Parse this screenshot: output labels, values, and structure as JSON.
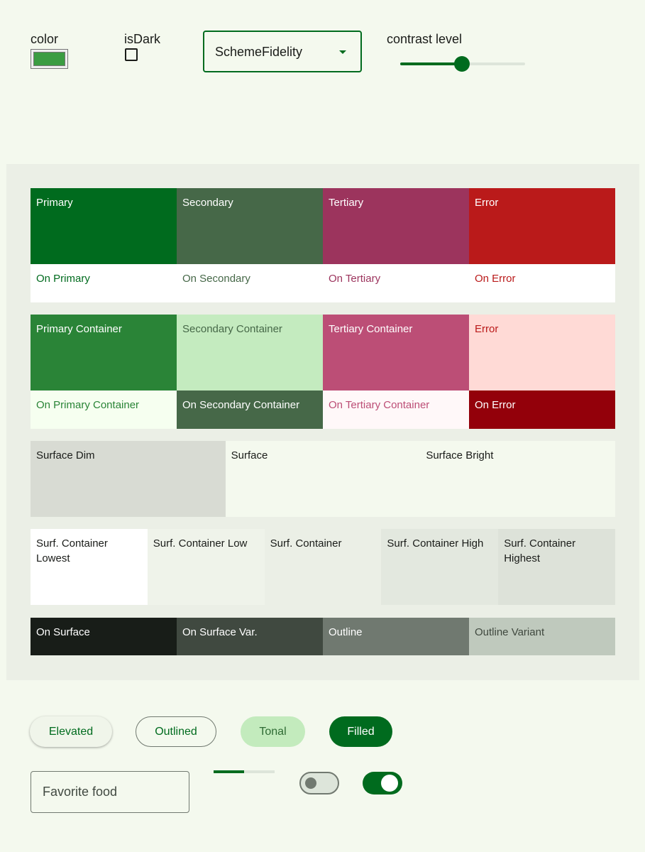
{
  "controls": {
    "color_label": "color",
    "color_value": "#3b9c42",
    "is_dark_label": "isDark",
    "is_dark_checked": false,
    "scheme_select": "SchemeFidelity",
    "contrast_label": "contrast level",
    "contrast_level": 0.5
  },
  "scheme": {
    "row1": [
      {
        "label": "Primary",
        "bg": "#006b1e",
        "fg": "#ffffff"
      },
      {
        "label": "Secondary",
        "bg": "#466848",
        "fg": "#ffffff"
      },
      {
        "label": "Tertiary",
        "bg": "#9c345d",
        "fg": "#ffffff"
      },
      {
        "label": "Error",
        "bg": "#ba1a1a",
        "fg": "#ffffff"
      }
    ],
    "row1_on": [
      {
        "label": "On Primary",
        "bg": "#ffffff",
        "fg": "#006b1e"
      },
      {
        "label": "On Secondary",
        "bg": "#ffffff",
        "fg": "#466848"
      },
      {
        "label": "On Tertiary",
        "bg": "#ffffff",
        "fg": "#9c345d"
      },
      {
        "label": "On Error",
        "bg": "#ffffff",
        "fg": "#ba1a1a"
      }
    ],
    "row2": [
      {
        "label": "Primary Container",
        "bg": "#2a8437",
        "fg": "#ffffff"
      },
      {
        "label": "Secondary Container",
        "bg": "#c4ebbf",
        "fg": "#466848"
      },
      {
        "label": "Tertiary Container",
        "bg": "#bc4e76",
        "fg": "#ffffff"
      },
      {
        "label": "Error",
        "bg": "#ffdad6",
        "fg": "#ba1a1a"
      }
    ],
    "row2_on": [
      {
        "label": "On Primary Container",
        "bg": "#f6fff0",
        "fg": "#2a8437"
      },
      {
        "label": "On Secondary Container",
        "bg": "#466848",
        "fg": "#ffffff"
      },
      {
        "label": "On Tertiary Container",
        "bg": "#fff8f9",
        "fg": "#bc4e76"
      },
      {
        "label": "On Error",
        "bg": "#93000a",
        "fg": "#ffffff"
      }
    ],
    "surface": [
      {
        "label": "Surface Dim",
        "bg": "#d8dbd3"
      },
      {
        "label": "Surface",
        "bg": "#f4f9ee"
      },
      {
        "label": "Surface Bright",
        "bg": "#f4f9ee"
      }
    ],
    "surface_containers": [
      {
        "label": "Surf. Container Lowest",
        "bg": "#ffffff"
      },
      {
        "label": "Surf. Container Low",
        "bg": "#eff3ea"
      },
      {
        "label": "Surf. Container",
        "bg": "#ebefe6"
      },
      {
        "label": "Surf. Container High",
        "bg": "#e3e8df"
      },
      {
        "label": "Surf. Container Highest",
        "bg": "#dde2d9"
      }
    ],
    "on_surface": [
      {
        "label": "On Surface",
        "bg": "#181d18",
        "fg": "#ffffff"
      },
      {
        "label": "On Surface Var.",
        "bg": "#404940",
        "fg": "#ffffff"
      },
      {
        "label": "Outline",
        "bg": "#707970",
        "fg": "#ffffff"
      },
      {
        "label": "Outline Variant",
        "bg": "#bfc9bd",
        "fg": "#3f483e"
      }
    ]
  },
  "components": {
    "buttons": {
      "elevated": "Elevated",
      "outlined": "Outlined",
      "tonal": "Tonal",
      "filled": "Filled"
    },
    "textfield_placeholder": "Favorite food",
    "progress": 0.5,
    "switch_off_checked": false,
    "switch_on_checked": true
  }
}
